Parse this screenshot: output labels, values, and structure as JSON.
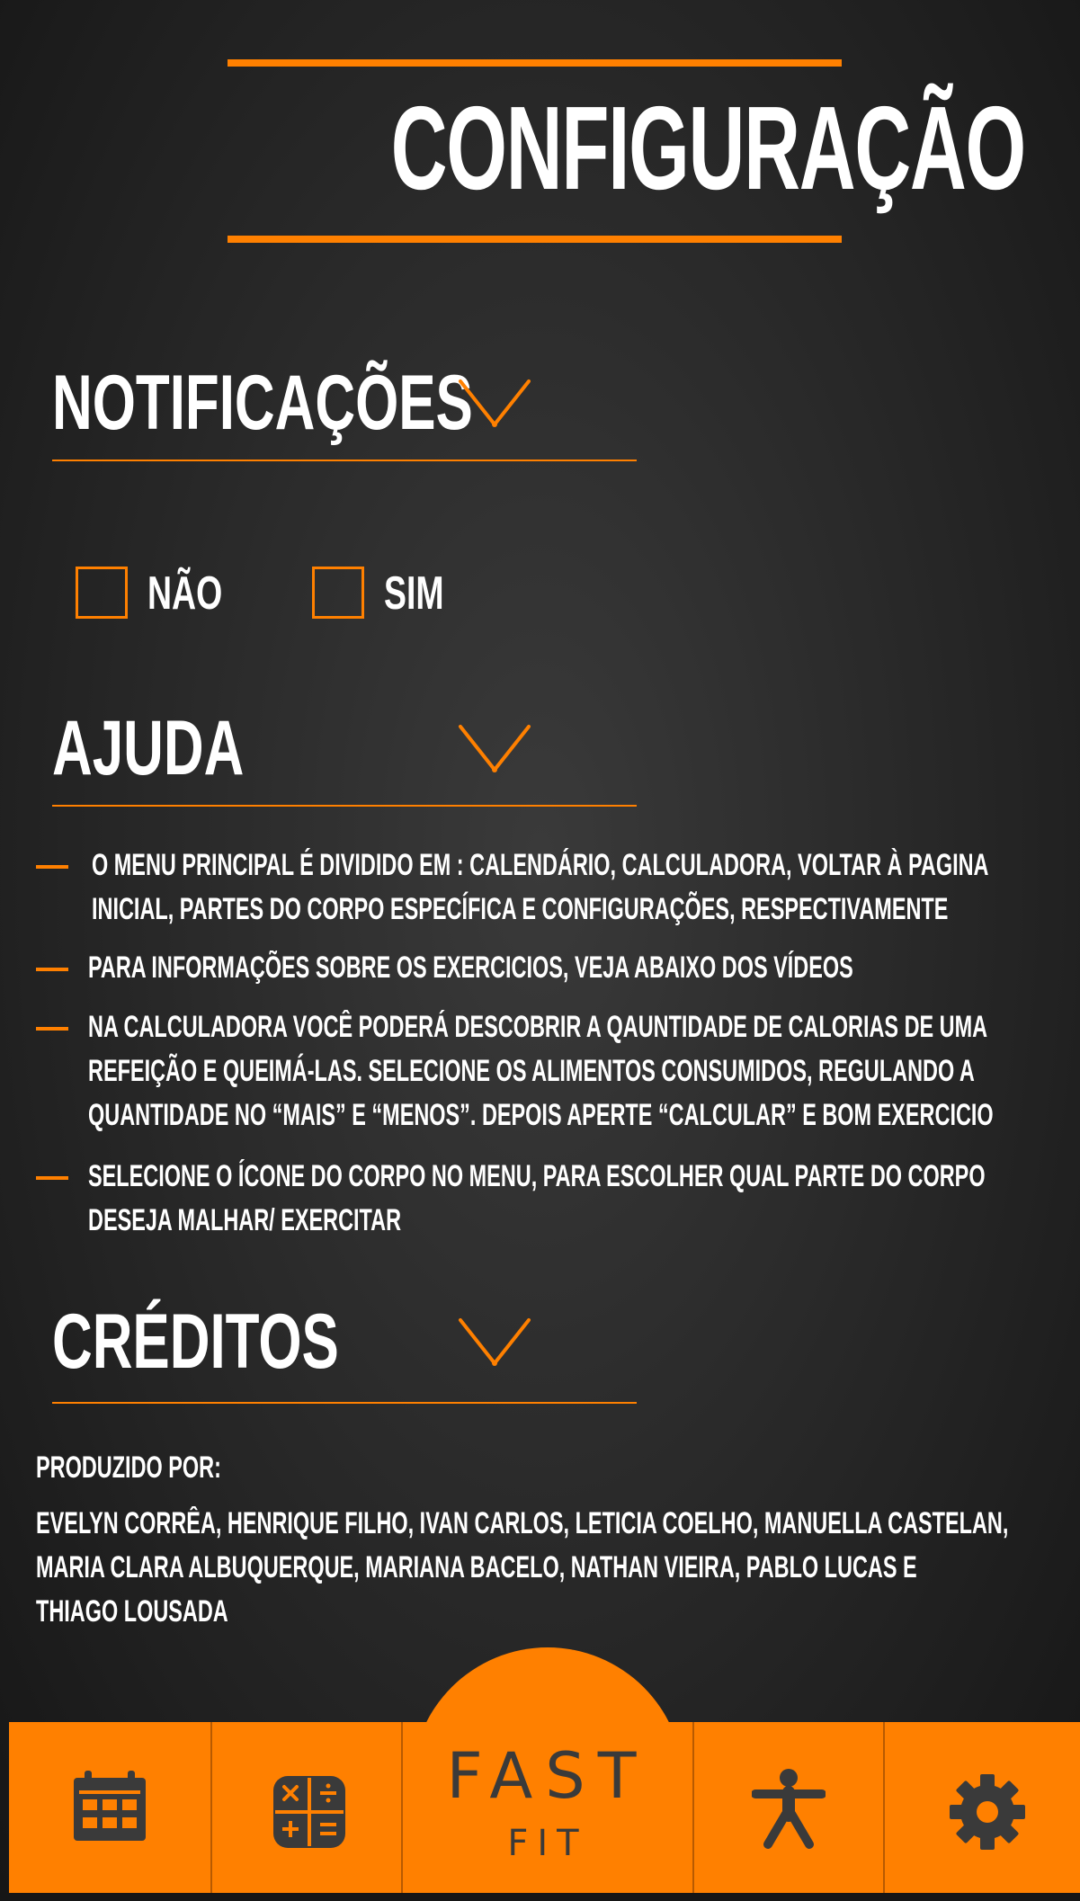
{
  "page": {
    "title": "CONFIGURAÇÃO"
  },
  "colors": {
    "accent": "#ff8000",
    "background": "#2a2a2a",
    "text": "#ffffff",
    "icon_dark": "#3a3a3a"
  },
  "notifications": {
    "heading": "NOTIFICAÇÕES",
    "toggle_icon": "chevron-down-icon",
    "options": [
      {
        "label": "NÃO",
        "checked": false
      },
      {
        "label": "SIM",
        "checked": false
      }
    ]
  },
  "help": {
    "heading": "AJUDA",
    "toggle_icon": "chevron-down-icon",
    "items": [
      {
        "lines": [
          "O MENU PRINCIPAL É DIVIDIDO EM :  CALENDÁRIO, CALCULADORA, VOLTAR À PAGINA",
          "INICIAL, PARTES DO CORPO ESPECÍFICA E CONFIGURAÇÕES, RESPECTIVAMENTE"
        ]
      },
      {
        "lines": [
          "PARA INFORMAÇÕES SOBRE OS EXERCICIOS, VEJA ABAIXO DOS VÍDEOS"
        ]
      },
      {
        "lines": [
          "NA CALCULADORA VOCÊ PODERÁ DESCOBRIR A QAUNTIDADE DE CALORIAS DE UMA",
          "REFEIÇÃO E QUEIMÁ-LAS. SELECIONE OS ALIMENTOS CONSUMIDOS, REGULANDO A",
          "QUANTIDADE NO “MAIS” E “MENOS”. DEPOIS APERTE “CALCULAR” E BOM EXERCICIO"
        ]
      },
      {
        "lines": [
          "SELECIONE O ÍCONE DO CORPO NO MENU,  PARA ESCOLHER QUAL PARTE DO CORPO",
          "DESEJA MALHAR/ EXERCITAR"
        ]
      }
    ]
  },
  "credits": {
    "heading": "CRÉDITOS",
    "toggle_icon": "chevron-down-icon",
    "produced_by_label": "PRODUZIDO POR:",
    "names_lines": [
      "EVELYN CORRÊA,  HENRIQUE FILHO, IVAN CARLOS,  LETICIA COELHO, MANUELLA CASTELAN,",
      "MARIA CLARA ALBUQUERQUE, MARIANA BACELO, NATHAN VIEIRA, PABLO LUCAS E",
      "THIAGO LOUSADA"
    ]
  },
  "bottom_nav": {
    "items": [
      {
        "icon": "calendar-icon"
      },
      {
        "icon": "calculator-icon"
      },
      {
        "icon": "home-logo"
      },
      {
        "icon": "body-icon"
      },
      {
        "icon": "gear-icon"
      }
    ],
    "brand_top": "FAST",
    "brand_bottom": "FIT"
  }
}
